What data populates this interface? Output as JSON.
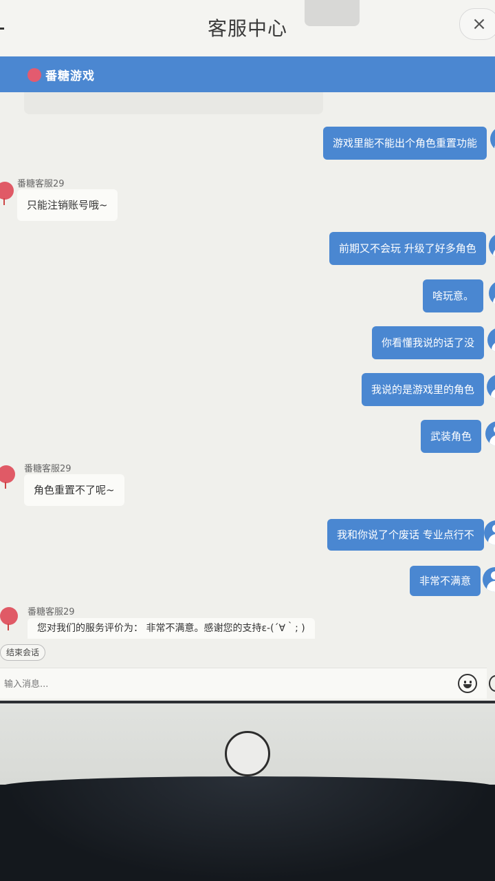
{
  "header": {
    "title": "客服中心",
    "close_icon": "×"
  },
  "brand": {
    "name": "番糖游戏"
  },
  "messages": {
    "m1": "游戏里能不能出个角色重置功能",
    "agent_name_1": "番糖客服29",
    "a1": "只能注销账号哦~",
    "m2": "前期又不会玩 升级了好多角色",
    "m3": "啥玩意。",
    "m4": "你看懂我说的话了没",
    "m5": "我说的是游戏里的角色",
    "m6": "武装角色",
    "agent_name_2": "番糖客服29",
    "a2": "角色重置不了呢~",
    "m7": "我和你说了个废话 专业点行不",
    "m8": "非常不满意",
    "agent_name_3": "番糖客服29",
    "a3": "您对我们的服务评价为： 非常不满意。感谢您的支持ε-(´∀｀; )"
  },
  "composer": {
    "end_session_label": "结束会话",
    "input_placeholder": "输入消息..."
  },
  "colors": {
    "accent": "#4a87d1",
    "agent_avatar": "#e05a66"
  }
}
